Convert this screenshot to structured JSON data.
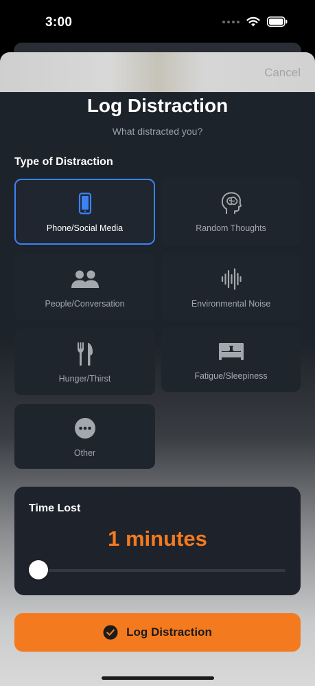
{
  "status_bar": {
    "time": "3:00"
  },
  "header": {
    "cancel_label": "Cancel"
  },
  "title": "Log Distraction",
  "subtitle": "What distracted you?",
  "section": {
    "type_label": "Type of Distraction"
  },
  "distraction_types": [
    {
      "label": "Phone/Social Media",
      "icon": "phone-icon",
      "selected": true
    },
    {
      "label": "Random Thoughts",
      "icon": "brain-head-icon",
      "selected": false
    },
    {
      "label": "People/Conversation",
      "icon": "people-icon",
      "selected": false
    },
    {
      "label": "Environmental Noise",
      "icon": "waveform-icon",
      "selected": false
    },
    {
      "label": "Hunger/Thirst",
      "icon": "fork-knife-icon",
      "selected": false
    },
    {
      "label": "Fatigue/Sleepiness",
      "icon": "bed-icon",
      "selected": false
    },
    {
      "label": "Other",
      "icon": "ellipsis-circle-icon",
      "selected": false
    }
  ],
  "time_lost": {
    "label": "Time Lost",
    "value_text": "1 minutes",
    "minutes": 1
  },
  "submit": {
    "label": "Log Distraction",
    "icon": "checkmark-circle-icon"
  },
  "colors": {
    "accent": "#f47a1f",
    "selected_border": "#3b82f6",
    "card": "#1f252d"
  }
}
